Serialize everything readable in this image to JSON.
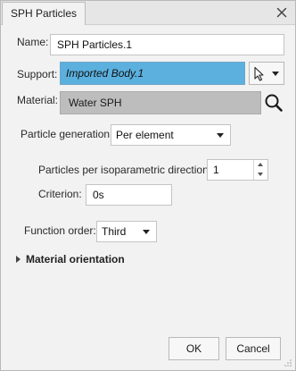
{
  "window": {
    "tab_title": "SPH Particles"
  },
  "form": {
    "name_label": "Name:",
    "name_value": "SPH Particles.1",
    "support_label": "Support:",
    "support_value": "Imported Body.1",
    "material_label": "Material:",
    "material_value": "Water SPH",
    "particle_generation_label": "Particle generation:",
    "particle_generation_value": "Per element",
    "particles_per_direction_label": "Particles per isoparametric direction:",
    "particles_per_direction_value": "1",
    "criterion_label": "Criterion:",
    "criterion_value": "0s",
    "function_order_label": "Function order:",
    "function_order_value": "Third"
  },
  "section": {
    "material_orientation_label": "Material orientation"
  },
  "buttons": {
    "ok_label": "OK",
    "cancel_label": "Cancel"
  },
  "colors": {
    "support_highlight": "#5bb0de",
    "material_field": "#bdbdbd",
    "dialog_bg": "#f2f2f2"
  }
}
